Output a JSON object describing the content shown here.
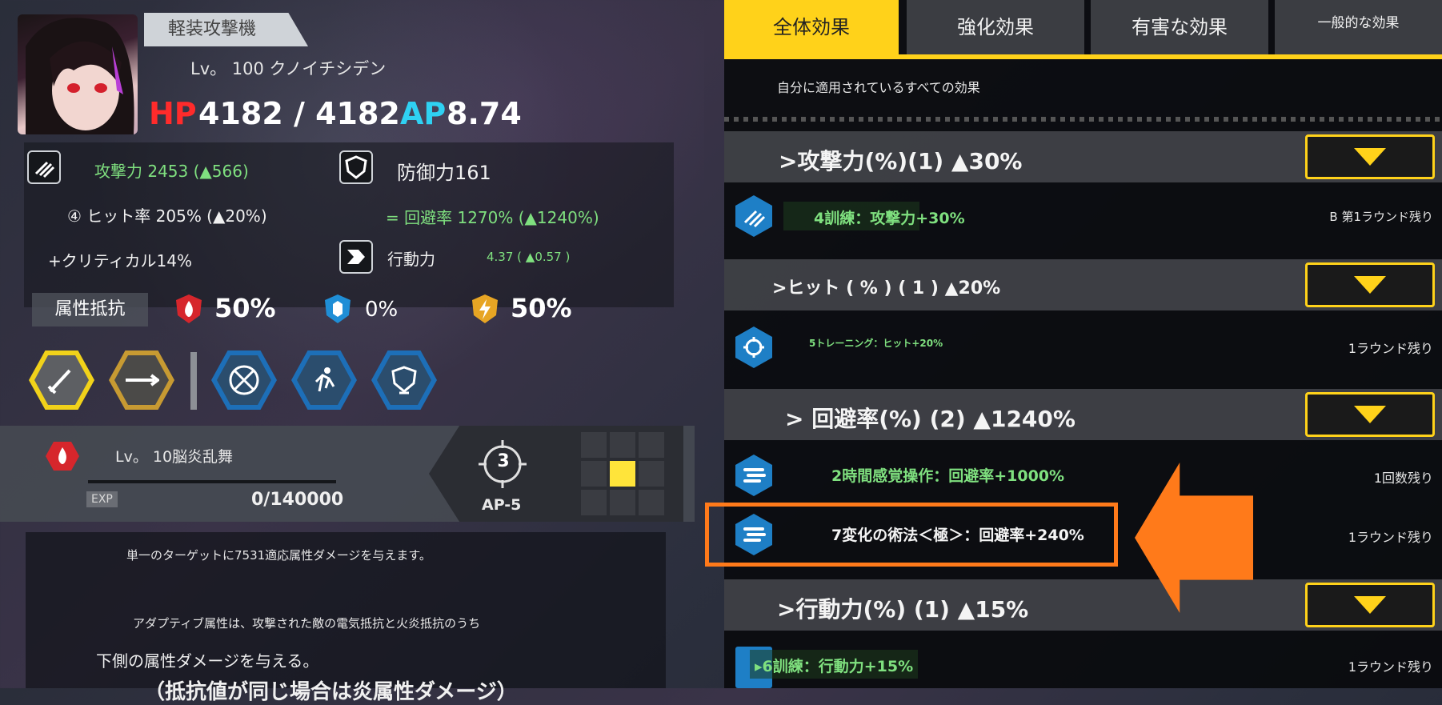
{
  "unit": {
    "role": "軽装攻撃機",
    "lv_name": "Lv。 100 クノイチシデン",
    "hp_label": "HP",
    "hp_value": "4182 / 4182",
    "ap_label": "AP",
    "ap_value": "8.74"
  },
  "stats": {
    "attack": "攻撃力 2453 (▲566)",
    "defense": "防御力161",
    "hit": "④ ヒット率 205% (▲20%)",
    "evasion": "= 回避率 1270% (▲1240%)",
    "critical": "+クリティカル14%",
    "mobility_label": "行動力",
    "mobility_value": "4.37 ( ▲0.57 )"
  },
  "resist": {
    "label": "属性抵抗",
    "fire": "50%",
    "ice": "0%",
    "electric": "50%"
  },
  "skill": {
    "lv_name": "Lv。 10脳炎乱舞",
    "exp_label": "EXP",
    "exp_value": "0/140000",
    "range": "3",
    "ap_cost": "AP-5"
  },
  "description": {
    "line1": "単一のターゲットに7531適応属性ダメージを与えます。",
    "line2": "アダプティブ属性は、攻撃された敵の電気抵抗と火炎抵抗のうち",
    "line3": "下側の属性ダメージを与える。",
    "line4": "（抵抗値が同じ場合は炎属性ダメージ）"
  },
  "tabs": [
    "全体効果",
    "強化効果",
    "有害な効果",
    "一般的な効果"
  ],
  "subtitle": "自分に適用されているすべての効果",
  "groups": [
    {
      "title": ">攻撃力(%)(1) ▲30%"
    },
    {
      "title": ">ヒット ( % ) ( 1 ) ▲20%"
    },
    {
      "title": "> 回避率(%) (2) ▲1240%"
    },
    {
      "title": ">行動力(%) (1) ▲15%"
    }
  ],
  "effects": [
    {
      "text": "4訓練：攻撃力+30%",
      "remaining": "B 第1ラウンド残り"
    },
    {
      "text": "5トレーニング：ヒット+20%",
      "remaining": "1ラウンド残り"
    },
    {
      "text": "2時間感覚操作：回避率+1000%",
      "remaining": "1回数残り"
    },
    {
      "text": "7変化の術法＜極＞：回避率+240%",
      "remaining": "1ラウンド残り"
    },
    {
      "text": "▸6訓練：行動力+15%",
      "remaining": "1ラウンド残り"
    }
  ],
  "colors": {
    "accent": "#ffd21a",
    "highlight": "#ff7a1a",
    "buff_text": "#7fe07f",
    "hp": "#ff2b2b",
    "ap": "#2fd1f2"
  }
}
